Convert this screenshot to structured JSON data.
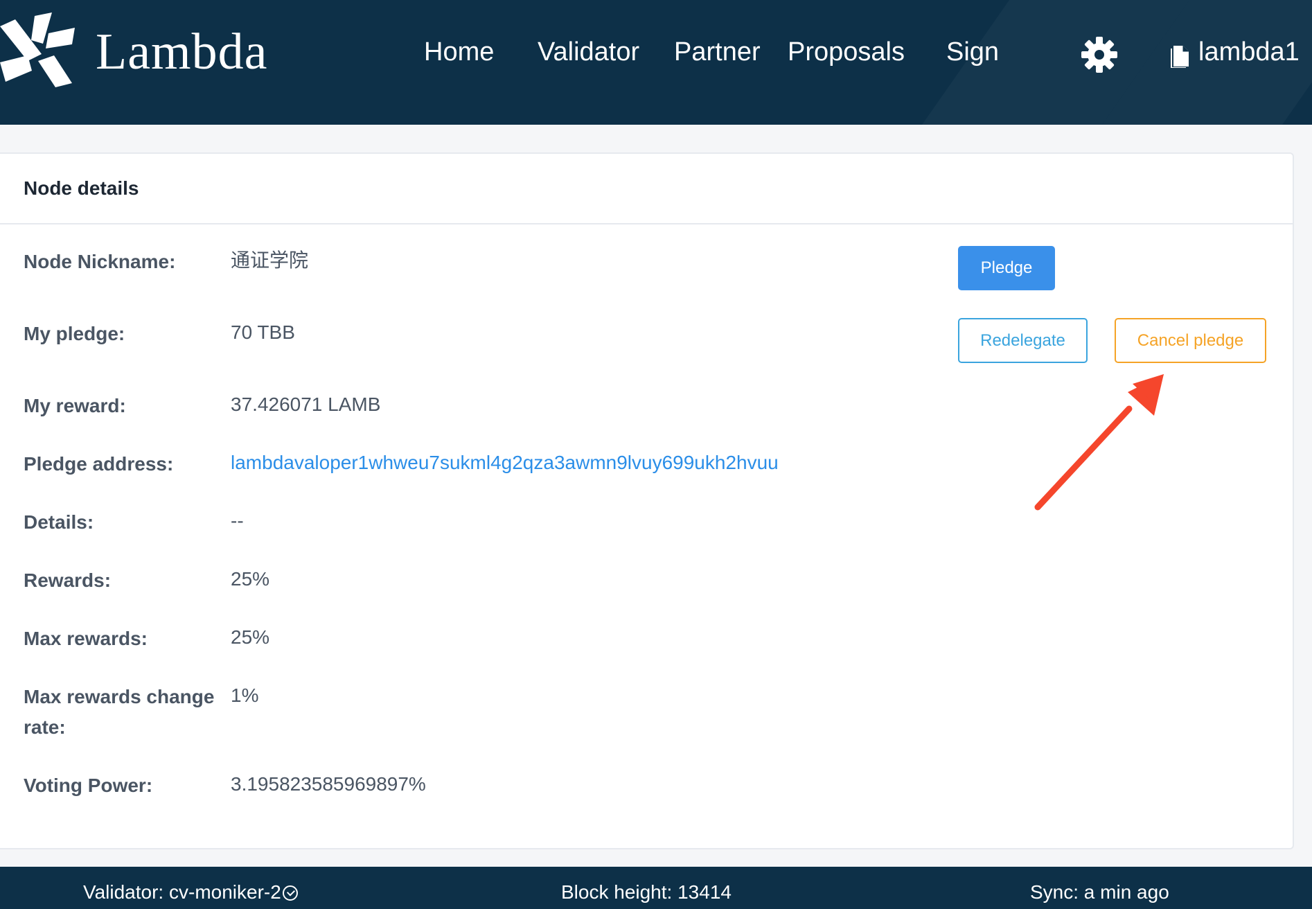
{
  "header": {
    "brand": "Lambda",
    "nav": [
      "Home",
      "Validator",
      "Partner",
      "Proposals",
      "Sign"
    ],
    "account": "lambda1",
    "icons": {
      "logo": "lambda-logo-icon",
      "settings": "gear-icon",
      "wallet": "document-icon"
    }
  },
  "card": {
    "title": "Node details",
    "fields": [
      {
        "label": "Node Nickname:",
        "value": "通证学院"
      },
      {
        "label": "My pledge:",
        "value": "70 TBB"
      },
      {
        "label": "My reward:",
        "value": "37.426071 LAMB"
      },
      {
        "label": "Pledge address:",
        "value": "lambdavaloper1whweu7sukml4g2qza3awmn9lvuy699ukh2hvuu"
      },
      {
        "label": "Details:",
        "value": "--"
      },
      {
        "label": "Rewards:",
        "value": "25%"
      },
      {
        "label": "Max rewards:",
        "value": "25%"
      },
      {
        "label": "Max rewards change rate:",
        "value": "1%"
      },
      {
        "label": "Voting Power:",
        "value": "3.195823585969897%"
      }
    ],
    "buttons": {
      "pledge": "Pledge",
      "redelegate": "Redelegate",
      "cancel_pledge": "Cancel pledge"
    }
  },
  "footer": {
    "validator": "Validator: cv-moniker-2",
    "block_height": "Block height: 13414",
    "sync": "Sync: a min ago"
  },
  "colors": {
    "header_bg": "#0d3048",
    "primary": "#3a90ea",
    "redelegate": "#3aa4de",
    "cancel": "#f5a326",
    "annotation_arrow": "#f5462c"
  }
}
